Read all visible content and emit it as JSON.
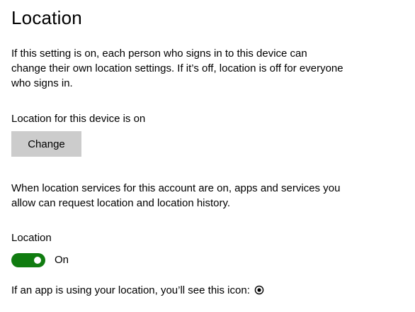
{
  "page": {
    "title": "Location"
  },
  "device_section": {
    "description": "If this setting is on, each person who signs in to this device can change their own location settings. If it’s off, location is off for everyone who signs in.",
    "status": "Location for this device is on",
    "change_button_label": "Change"
  },
  "account_section": {
    "description": "When location services for this account are on, apps and services you allow can request location and location history.",
    "toggle_label": "Location",
    "toggle_state": "On",
    "toggle_on": true,
    "toggle_color": "#107c10"
  },
  "icon_note": {
    "text": "If an app is using your location, you’ll see this icon:",
    "icon": "location-in-use-icon"
  }
}
